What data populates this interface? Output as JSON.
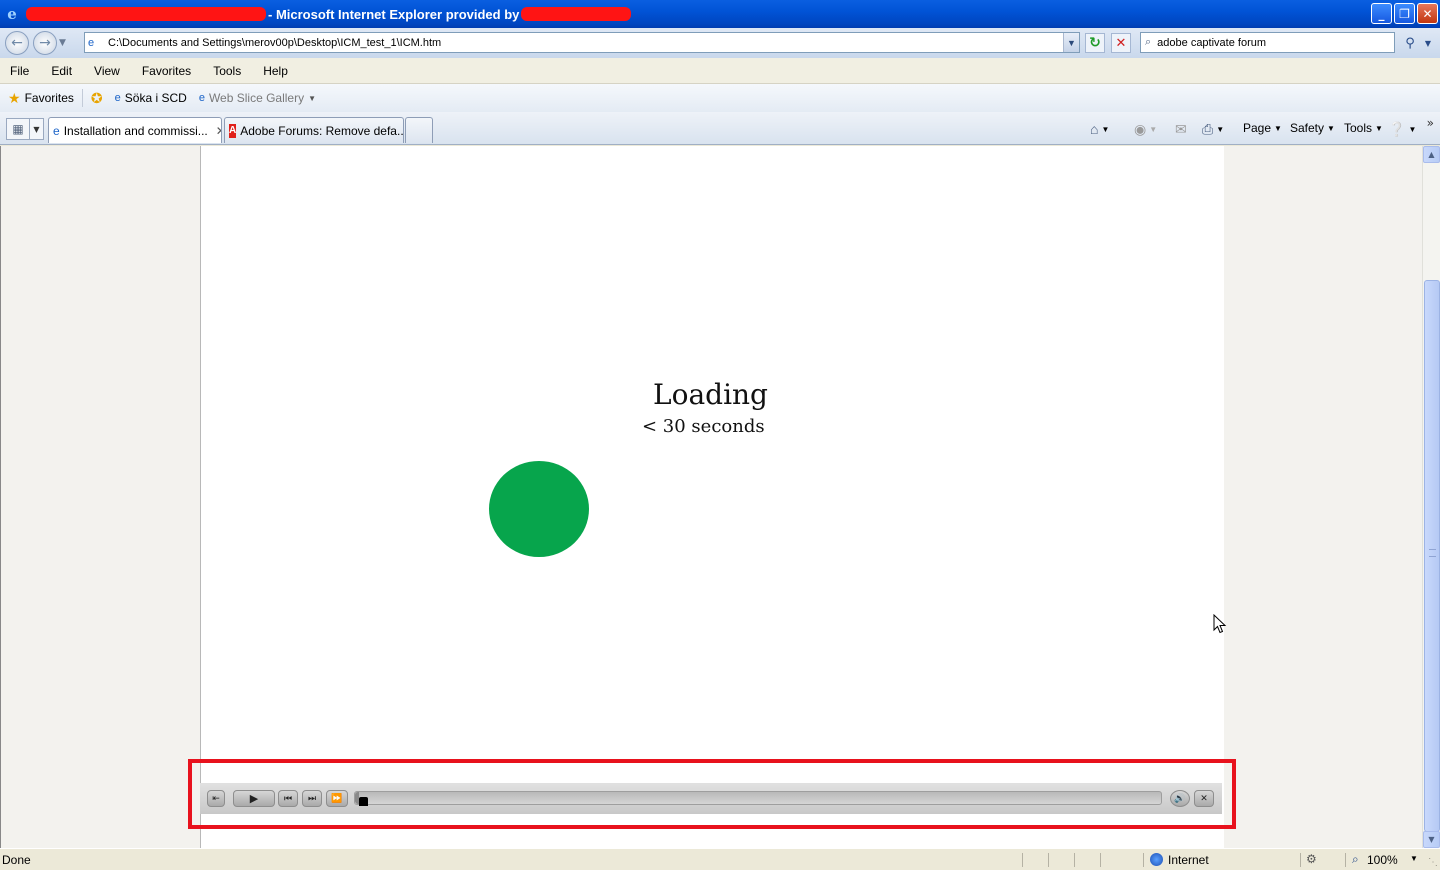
{
  "window": {
    "title": "- Microsoft Internet Explorer provided by",
    "minimize_glyph": "_",
    "restore_glyph": "❐",
    "close_glyph": "✕"
  },
  "address_bar": {
    "url": "C:\\Documents and Settings\\merov00p\\Desktop\\ICM_test_1\\ICM.htm",
    "search_value": "adobe captivate forum"
  },
  "menu": [
    "File",
    "Edit",
    "View",
    "Favorites",
    "Tools",
    "Help"
  ],
  "favorites_bar": {
    "favorites_label": "Favorites",
    "links": [
      "Söka i SCD",
      "Web Slice Gallery"
    ]
  },
  "tabs": [
    {
      "label": "Installation and commissi...",
      "active": true
    },
    {
      "label": "Adobe Forums: Remove defa...",
      "active": false
    }
  ],
  "command_bar": {
    "page": "Page",
    "safety": "Safety",
    "tools": "Tools"
  },
  "content": {
    "loading_title": "Loading",
    "loading_subtitle": "< 30 seconds"
  },
  "playbar": {
    "progress": 0.005
  },
  "status_bar": {
    "status": "Done",
    "zone": "Internet",
    "zoom": "100%"
  },
  "colors": {
    "highlight": "#e8121d",
    "loading_dot": "#07a54c"
  },
  "icons": {
    "browser": "ie-icon",
    "refresh": "refresh-icon",
    "stop": "stop-icon",
    "search": "search-icon",
    "home": "home-icon",
    "feeds": "feeds-icon",
    "print": "print-icon",
    "help": "help-icon"
  }
}
